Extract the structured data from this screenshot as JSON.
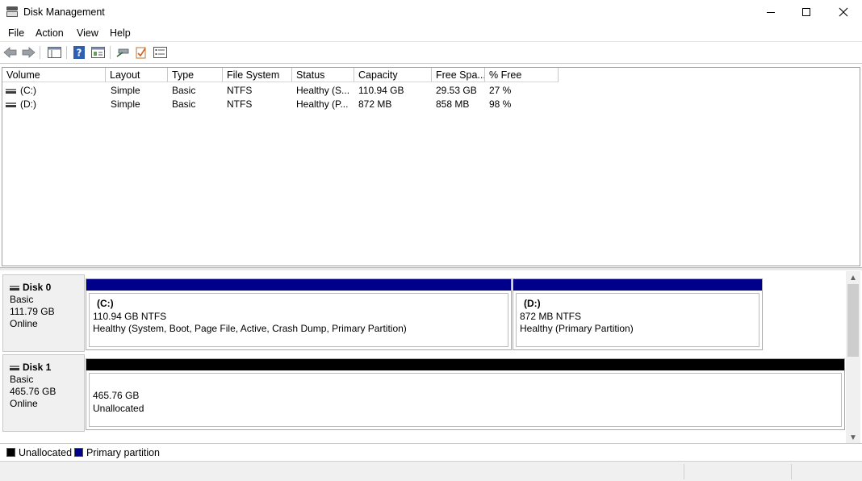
{
  "window": {
    "title": "Disk Management",
    "controls": {
      "minimize": "minimize",
      "maximize": "maximize",
      "close": "close"
    }
  },
  "menu": [
    "File",
    "Action",
    "View",
    "Help"
  ],
  "toolbar": {
    "icons": [
      "back-icon",
      "forward-icon",
      "show-hide-console-tree-icon",
      "help-icon",
      "properties-icon",
      "connect-disk-icon",
      "check-icon",
      "list-view-icon"
    ]
  },
  "volume_table": {
    "columns": [
      "Volume",
      "Layout",
      "Type",
      "File System",
      "Status",
      "Capacity",
      "Free Spa...",
      "% Free"
    ],
    "rows": [
      [
        "(C:)",
        "Simple",
        "Basic",
        "NTFS",
        "Healthy (S...",
        "110.94 GB",
        "29.53 GB",
        "27 %"
      ],
      [
        "(D:)",
        "Simple",
        "Basic",
        "NTFS",
        "Healthy (P...",
        "872 MB",
        "858 MB",
        "98 %"
      ]
    ]
  },
  "disks": [
    {
      "name": "Disk 0",
      "type": "Basic",
      "size": "111.79 GB",
      "state": "Online",
      "partitions": [
        {
          "title": "(C:)",
          "size": "110.94 GB NTFS",
          "status": "Healthy (System, Boot, Page File, Active, Crash Dump, Primary Partition)",
          "bar_color": "#00008b"
        },
        {
          "title": "(D:)",
          "size": "872 MB NTFS",
          "status": "Healthy (Primary Partition)",
          "bar_color": "#00008b"
        }
      ]
    },
    {
      "name": "Disk 1",
      "type": "Basic",
      "size": "465.76 GB",
      "state": "Online",
      "partitions": [
        {
          "size": "465.76 GB",
          "status": "Unallocated",
          "bar_color": "#000000"
        }
      ]
    }
  ],
  "legend": [
    {
      "label": "Unallocated",
      "color": "#000000"
    },
    {
      "label": "Primary partition",
      "color": "#00008b"
    }
  ]
}
